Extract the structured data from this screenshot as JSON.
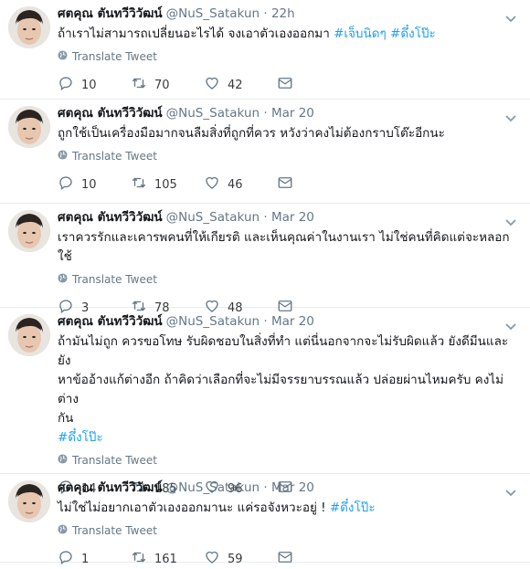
{
  "author": {
    "display_name": "ศตคุณ ตันทวีวิวัฒน์",
    "handle": "@NuS_Satakun"
  },
  "ui": {
    "translate_label": "Translate Tweet",
    "colors": {
      "hashtag": "#1da1f2",
      "meta": "#657786",
      "divider": "#e6ecf0"
    }
  },
  "tweets": [
    {
      "time": "22h",
      "text_lines": [
        "ถ้าเราไม่สามารถเปลี่ยนอะไรได้ จงเอาตัวเองออกมา "
      ],
      "hashtags_inline": [
        "#เจ็บนิดๆ",
        "#ดึ๋งโป๊ะ"
      ],
      "replies": "10",
      "retweets": "70",
      "likes": "42"
    },
    {
      "time": "Mar 20",
      "text_lines": [
        "ถูกใช้เป็นเครื่องมือมากจนลืมสิ่งที่ถูกที่ควร หวังว่าคงไม่ต้องกราบโต๊ะอีกนะ"
      ],
      "replies": "10",
      "retweets": "105",
      "likes": "46"
    },
    {
      "time": "Mar 20",
      "text_lines": [
        "เราควรรักและเคารพคนที่ให้เกียรติ และเห็นคุณค่าในงานเรา ไม่ใช่คนที่คิดแต่จะหลอกใช้"
      ],
      "replies": "3",
      "retweets": "78",
      "likes": "48"
    },
    {
      "time": "Mar 20",
      "text_lines": [
        "ถ้ามันไม่ถูก ควรขอโทษ รับผิดชอบในสิ่งที่ทำ แต่นี่นอกจากจะไม่รับผิดแล้ว ยังดีมีนและยัง",
        "หาข้ออ้างแก้ต่างอีก ถ้าคิดว่าเลือกที่จะไม่มีจรรยาบรรณแล้ว ปล่อยผ่านไหมครับ คงไม่ต่าง",
        "กัน"
      ],
      "hashtag_line": "#ดึ๋งโป๊ะ",
      "replies": "14",
      "retweets": "185",
      "likes": "96"
    },
    {
      "time": "Mar 20",
      "text_lines": [
        "ไม่ใช่ไม่อยากเอาตัวเองออกมานะ แค่รอจังหวะอยู่ ! "
      ],
      "hashtags_inline": [
        "#ดึ๋งโป๊ะ"
      ],
      "replies": "1",
      "retweets": "161",
      "likes": "59"
    }
  ]
}
